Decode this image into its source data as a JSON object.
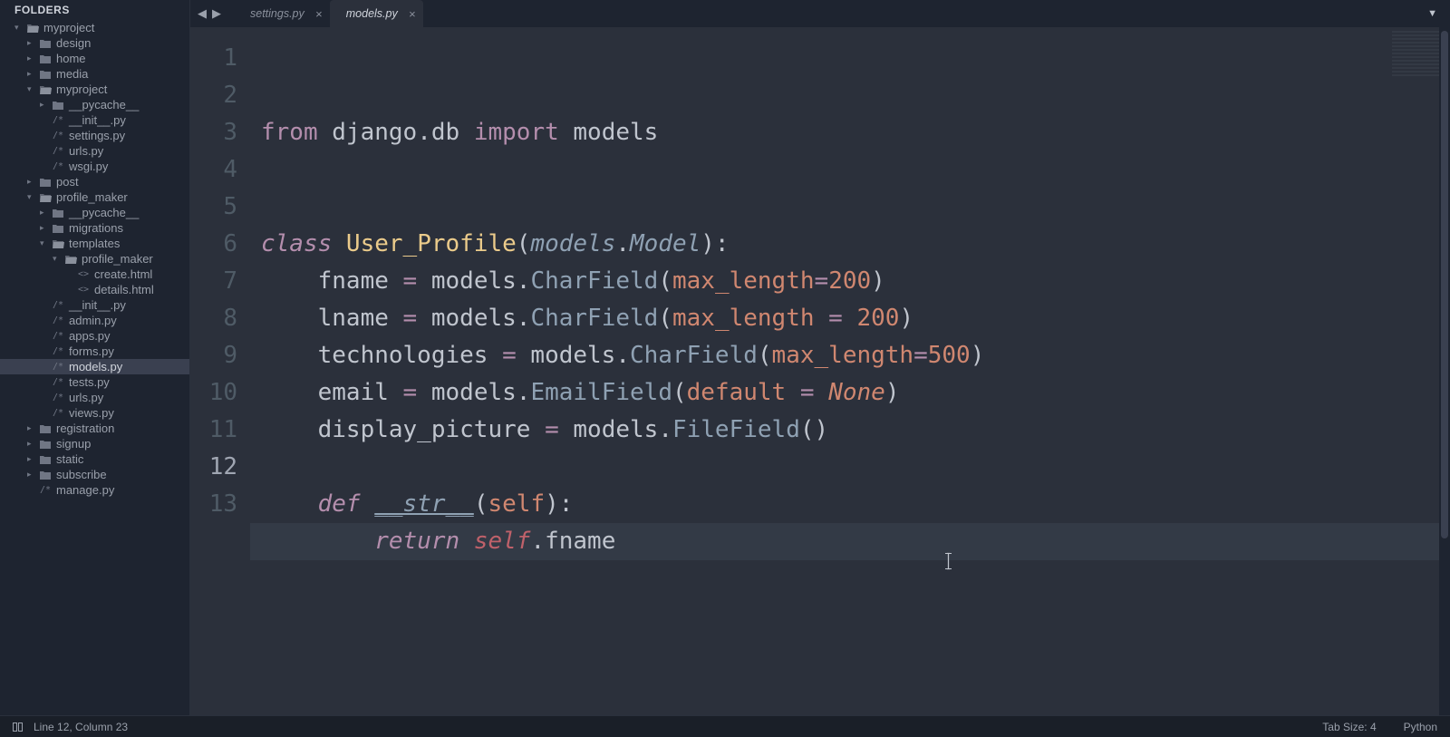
{
  "sidebar": {
    "header": "FOLDERS",
    "tree": [
      {
        "indent": 0,
        "type": "folder-open",
        "arrow": "▾",
        "label": "myproject"
      },
      {
        "indent": 1,
        "type": "folder",
        "arrow": "▸",
        "label": "design"
      },
      {
        "indent": 1,
        "type": "folder",
        "arrow": "▸",
        "label": "home"
      },
      {
        "indent": 1,
        "type": "folder",
        "arrow": "▸",
        "label": "media"
      },
      {
        "indent": 1,
        "type": "folder-open",
        "arrow": "▾",
        "label": "myproject"
      },
      {
        "indent": 2,
        "type": "folder",
        "arrow": "▸",
        "label": "__pycache__"
      },
      {
        "indent": 2,
        "type": "file",
        "glyph": "/*",
        "label": "__init__.py"
      },
      {
        "indent": 2,
        "type": "file",
        "glyph": "/*",
        "label": "settings.py"
      },
      {
        "indent": 2,
        "type": "file",
        "glyph": "/*",
        "label": "urls.py"
      },
      {
        "indent": 2,
        "type": "file",
        "glyph": "/*",
        "label": "wsgi.py"
      },
      {
        "indent": 1,
        "type": "folder",
        "arrow": "▸",
        "label": "post"
      },
      {
        "indent": 1,
        "type": "folder-open",
        "arrow": "▾",
        "label": "profile_maker"
      },
      {
        "indent": 2,
        "type": "folder",
        "arrow": "▸",
        "label": "__pycache__"
      },
      {
        "indent": 2,
        "type": "folder",
        "arrow": "▸",
        "label": "migrations"
      },
      {
        "indent": 2,
        "type": "folder-open",
        "arrow": "▾",
        "label": "templates"
      },
      {
        "indent": 3,
        "type": "folder-open",
        "arrow": "▾",
        "label": "profile_maker"
      },
      {
        "indent": 4,
        "type": "file",
        "glyph": "<>",
        "label": "create.html"
      },
      {
        "indent": 4,
        "type": "file",
        "glyph": "<>",
        "label": "details.html"
      },
      {
        "indent": 2,
        "type": "file",
        "glyph": "/*",
        "label": "__init__.py"
      },
      {
        "indent": 2,
        "type": "file",
        "glyph": "/*",
        "label": "admin.py"
      },
      {
        "indent": 2,
        "type": "file",
        "glyph": "/*",
        "label": "apps.py"
      },
      {
        "indent": 2,
        "type": "file",
        "glyph": "/*",
        "label": "forms.py"
      },
      {
        "indent": 2,
        "type": "file",
        "glyph": "/*",
        "label": "models.py",
        "selected": true
      },
      {
        "indent": 2,
        "type": "file",
        "glyph": "/*",
        "label": "tests.py"
      },
      {
        "indent": 2,
        "type": "file",
        "glyph": "/*",
        "label": "urls.py"
      },
      {
        "indent": 2,
        "type": "file",
        "glyph": "/*",
        "label": "views.py"
      },
      {
        "indent": 1,
        "type": "folder",
        "arrow": "▸",
        "label": "registration"
      },
      {
        "indent": 1,
        "type": "folder",
        "arrow": "▸",
        "label": "signup"
      },
      {
        "indent": 1,
        "type": "folder",
        "arrow": "▸",
        "label": "static"
      },
      {
        "indent": 1,
        "type": "folder",
        "arrow": "▸",
        "label": "subscribe"
      },
      {
        "indent": 1,
        "type": "file",
        "glyph": "/*",
        "label": "manage.py"
      }
    ]
  },
  "tabs": {
    "nav_back": "◀",
    "nav_fwd": "▶",
    "items": [
      {
        "label": "settings.py",
        "active": false
      },
      {
        "label": "models.py",
        "active": true
      }
    ],
    "close_glyph": "×",
    "menu_glyph": "▼"
  },
  "editor": {
    "line_count": 13,
    "current_line": 12,
    "lines": [
      [
        {
          "t": "from ",
          "c": "hl-keyword"
        },
        {
          "t": "django",
          "c": "hl-name"
        },
        {
          "t": ".",
          "c": "hl-punct"
        },
        {
          "t": "db",
          "c": "hl-name"
        },
        {
          "t": " import ",
          "c": "hl-import"
        },
        {
          "t": "models",
          "c": "hl-name"
        }
      ],
      [],
      [],
      [
        {
          "t": "class ",
          "c": "hl-class"
        },
        {
          "t": "User_Profile",
          "c": "hl-classname"
        },
        {
          "t": "(",
          "c": "hl-punct"
        },
        {
          "t": "models",
          "c": "hl-type"
        },
        {
          "t": ".",
          "c": "hl-punct"
        },
        {
          "t": "Model",
          "c": "hl-type"
        },
        {
          "t": "):",
          "c": "hl-punct"
        }
      ],
      [
        {
          "t": "    fname ",
          "c": "hl-name"
        },
        {
          "t": "=",
          "c": "hl-keyword"
        },
        {
          "t": " models",
          "c": "hl-name"
        },
        {
          "t": ".",
          "c": "hl-punct"
        },
        {
          "t": "CharField",
          "c": "hl-func"
        },
        {
          "t": "(",
          "c": "hl-punct"
        },
        {
          "t": "max_length",
          "c": "hl-param"
        },
        {
          "t": "=",
          "c": "hl-keyword"
        },
        {
          "t": "200",
          "c": "hl-number"
        },
        {
          "t": ")",
          "c": "hl-punct"
        }
      ],
      [
        {
          "t": "    lname ",
          "c": "hl-name"
        },
        {
          "t": "=",
          "c": "hl-keyword"
        },
        {
          "t": " models",
          "c": "hl-name"
        },
        {
          "t": ".",
          "c": "hl-punct"
        },
        {
          "t": "CharField",
          "c": "hl-func"
        },
        {
          "t": "(",
          "c": "hl-punct"
        },
        {
          "t": "max_length",
          "c": "hl-param"
        },
        {
          "t": " = ",
          "c": "hl-keyword"
        },
        {
          "t": "200",
          "c": "hl-number"
        },
        {
          "t": ")",
          "c": "hl-punct"
        }
      ],
      [
        {
          "t": "    technologies ",
          "c": "hl-name"
        },
        {
          "t": "=",
          "c": "hl-keyword"
        },
        {
          "t": " models",
          "c": "hl-name"
        },
        {
          "t": ".",
          "c": "hl-punct"
        },
        {
          "t": "CharField",
          "c": "hl-func"
        },
        {
          "t": "(",
          "c": "hl-punct"
        },
        {
          "t": "max_length",
          "c": "hl-param"
        },
        {
          "t": "=",
          "c": "hl-keyword"
        },
        {
          "t": "500",
          "c": "hl-number"
        },
        {
          "t": ")",
          "c": "hl-punct"
        }
      ],
      [
        {
          "t": "    email ",
          "c": "hl-name"
        },
        {
          "t": "=",
          "c": "hl-keyword"
        },
        {
          "t": " models",
          "c": "hl-name"
        },
        {
          "t": ".",
          "c": "hl-punct"
        },
        {
          "t": "EmailField",
          "c": "hl-func"
        },
        {
          "t": "(",
          "c": "hl-punct"
        },
        {
          "t": "default",
          "c": "hl-param"
        },
        {
          "t": " = ",
          "c": "hl-keyword"
        },
        {
          "t": "None",
          "c": "hl-none"
        },
        {
          "t": ")",
          "c": "hl-punct"
        }
      ],
      [
        {
          "t": "    display_picture ",
          "c": "hl-name"
        },
        {
          "t": "=",
          "c": "hl-keyword"
        },
        {
          "t": " models",
          "c": "hl-name"
        },
        {
          "t": ".",
          "c": "hl-punct"
        },
        {
          "t": "FileField",
          "c": "hl-func"
        },
        {
          "t": "()",
          "c": "hl-punct"
        }
      ],
      [],
      [
        {
          "t": "    ",
          "c": ""
        },
        {
          "t": "def ",
          "c": "hl-def"
        },
        {
          "t": "__str__",
          "c": "hl-dunder"
        },
        {
          "t": "(",
          "c": "hl-punct"
        },
        {
          "t": "self",
          "c": "hl-param"
        },
        {
          "t": "):",
          "c": "hl-punct"
        }
      ],
      [
        {
          "t": "        ",
          "c": ""
        },
        {
          "t": "return ",
          "c": "hl-return"
        },
        {
          "t": "self",
          "c": "hl-self"
        },
        {
          "t": ".",
          "c": "hl-punct"
        },
        {
          "t": "fname",
          "c": "hl-name"
        }
      ],
      []
    ]
  },
  "status": {
    "cursor": "Line 12, Column 23",
    "tab_size": "Tab Size: 4",
    "language": "Python"
  }
}
